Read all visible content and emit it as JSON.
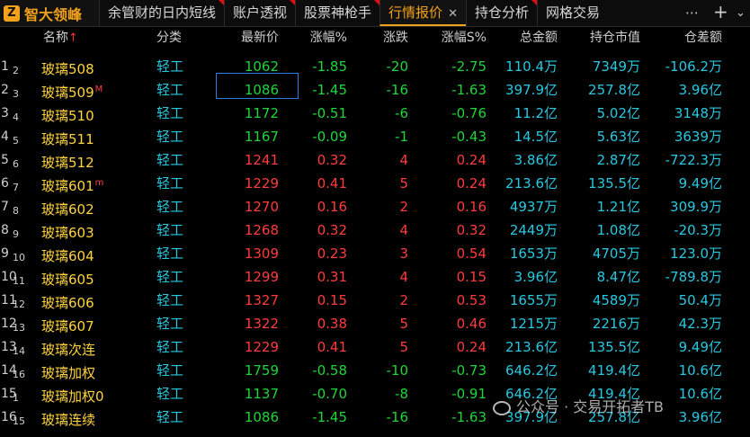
{
  "app": {
    "logo_text": "智大领峰",
    "logo_mark": "Z"
  },
  "tabs": [
    {
      "label": "余管财的日内短线",
      "active": false
    },
    {
      "label": "账户透视",
      "active": false
    },
    {
      "label": "股票神枪手",
      "active": false
    },
    {
      "label": "行情报价",
      "active": true
    },
    {
      "label": "持仓分析",
      "active": false
    },
    {
      "label": "网格交易",
      "active": false
    }
  ],
  "tab_close": "✕",
  "tab_controls": {
    "more": "⋯",
    "add": "+",
    "chevron": "⌄"
  },
  "columns": {
    "name": "名称",
    "name_sort": "↑",
    "category": "分类",
    "price": "最新价",
    "pct": "涨幅%",
    "change": "涨跌",
    "pct_s": "涨幅S%",
    "amount": "总金额",
    "holding_value": "持仓市值",
    "oi_diff": "仓差额"
  },
  "rows": [
    {
      "idx": "1",
      "sub": "2",
      "name": "玻璃508",
      "sup": "",
      "cat": "轻工",
      "price": "1062",
      "pct": "-1.85",
      "chg": "-20",
      "pcts": "-2.75",
      "amt": "110.4万",
      "hold": "7349万",
      "diff": "-106.2万",
      "dir": "down"
    },
    {
      "idx": "2",
      "sub": "3",
      "name": "玻璃509",
      "sup": "M",
      "cat": "轻工",
      "price": "1086",
      "pct": "-1.45",
      "chg": "-16",
      "pcts": "-1.63",
      "amt": "397.9亿",
      "hold": "257.8亿",
      "diff": "3.96亿",
      "dir": "down"
    },
    {
      "idx": "3",
      "sub": "4",
      "name": "玻璃510",
      "sup": "",
      "cat": "轻工",
      "price": "1172",
      "pct": "-0.51",
      "chg": "-6",
      "pcts": "-0.76",
      "amt": "11.2亿",
      "hold": "5.02亿",
      "diff": "3148万",
      "dir": "down"
    },
    {
      "idx": "4",
      "sub": "5",
      "name": "玻璃511",
      "sup": "",
      "cat": "轻工",
      "price": "1167",
      "pct": "-0.09",
      "chg": "-1",
      "pcts": "-0.43",
      "amt": "14.5亿",
      "hold": "5.63亿",
      "diff": "3639万",
      "dir": "down"
    },
    {
      "idx": "5",
      "sub": "6",
      "name": "玻璃512",
      "sup": "",
      "cat": "轻工",
      "price": "1241",
      "pct": "0.32",
      "chg": "4",
      "pcts": "0.24",
      "amt": "3.86亿",
      "hold": "2.87亿",
      "diff": "-722.3万",
      "dir": "up"
    },
    {
      "idx": "6",
      "sub": "7",
      "name": "玻璃601",
      "sup": "m",
      "cat": "轻工",
      "price": "1229",
      "pct": "0.41",
      "chg": "5",
      "pcts": "0.24",
      "amt": "213.6亿",
      "hold": "135.5亿",
      "diff": "9.49亿",
      "dir": "up"
    },
    {
      "idx": "7",
      "sub": "8",
      "name": "玻璃602",
      "sup": "",
      "cat": "轻工",
      "price": "1270",
      "pct": "0.16",
      "chg": "2",
      "pcts": "0.16",
      "amt": "4937万",
      "hold": "1.21亿",
      "diff": "309.9万",
      "dir": "up"
    },
    {
      "idx": "8",
      "sub": "9",
      "name": "玻璃603",
      "sup": "",
      "cat": "轻工",
      "price": "1268",
      "pct": "0.32",
      "chg": "4",
      "pcts": "0.32",
      "amt": "2449万",
      "hold": "1.08亿",
      "diff": "-20.3万",
      "dir": "up"
    },
    {
      "idx": "9",
      "sub": "10",
      "name": "玻璃604",
      "sup": "",
      "cat": "轻工",
      "price": "1309",
      "pct": "0.23",
      "chg": "3",
      "pcts": "0.54",
      "amt": "1653万",
      "hold": "4705万",
      "diff": "123.0万",
      "dir": "up"
    },
    {
      "idx": "10",
      "sub": "11",
      "name": "玻璃605",
      "sup": "",
      "cat": "轻工",
      "price": "1299",
      "pct": "0.31",
      "chg": "4",
      "pcts": "0.15",
      "amt": "3.96亿",
      "hold": "8.47亿",
      "diff": "-789.8万",
      "dir": "up"
    },
    {
      "idx": "11",
      "sub": "12",
      "name": "玻璃606",
      "sup": "",
      "cat": "轻工",
      "price": "1327",
      "pct": "0.15",
      "chg": "2",
      "pcts": "0.53",
      "amt": "1655万",
      "hold": "4589万",
      "diff": "50.4万",
      "dir": "up"
    },
    {
      "idx": "12",
      "sub": "13",
      "name": "玻璃607",
      "sup": "",
      "cat": "轻工",
      "price": "1322",
      "pct": "0.38",
      "chg": "5",
      "pcts": "0.46",
      "amt": "1215万",
      "hold": "2216万",
      "diff": "42.3万",
      "dir": "up"
    },
    {
      "idx": "13",
      "sub": "14",
      "name": "玻璃次连",
      "sup": "",
      "cat": "轻工",
      "price": "1229",
      "pct": "0.41",
      "chg": "5",
      "pcts": "0.24",
      "amt": "213.6亿",
      "hold": "135.5亿",
      "diff": "9.49亿",
      "dir": "up"
    },
    {
      "idx": "14",
      "sub": "16",
      "name": "玻璃加权",
      "sup": "",
      "cat": "轻工",
      "price": "1759",
      "pct": "-0.58",
      "chg": "-10",
      "pcts": "-0.73",
      "amt": "646.2亿",
      "hold": "419.4亿",
      "diff": "10.6亿",
      "dir": "down"
    },
    {
      "idx": "15",
      "sub": "1",
      "name": "玻璃加权0",
      "sup": "",
      "cat": "轻工",
      "price": "1137",
      "pct": "-0.70",
      "chg": "-8",
      "pcts": "-0.91",
      "amt": "646.2亿",
      "hold": "419.4亿",
      "diff": "10.6亿",
      "dir": "down"
    },
    {
      "idx": "16",
      "sub": "15",
      "name": "玻璃连续",
      "sup": "",
      "cat": "轻工",
      "price": "1086",
      "pct": "-1.45",
      "chg": "-16",
      "pcts": "-1.63",
      "amt": "397.9亿",
      "hold": "257.8亿",
      "diff": "3.96亿",
      "dir": "down"
    }
  ],
  "watermark": "公众号 · 交易开拓者TB",
  "colors": {
    "up": "#ff3c3c",
    "down": "#1fd63a",
    "name": "#ffd33d",
    "cyan": "#28c8e0",
    "accent": "#f2a11a"
  }
}
